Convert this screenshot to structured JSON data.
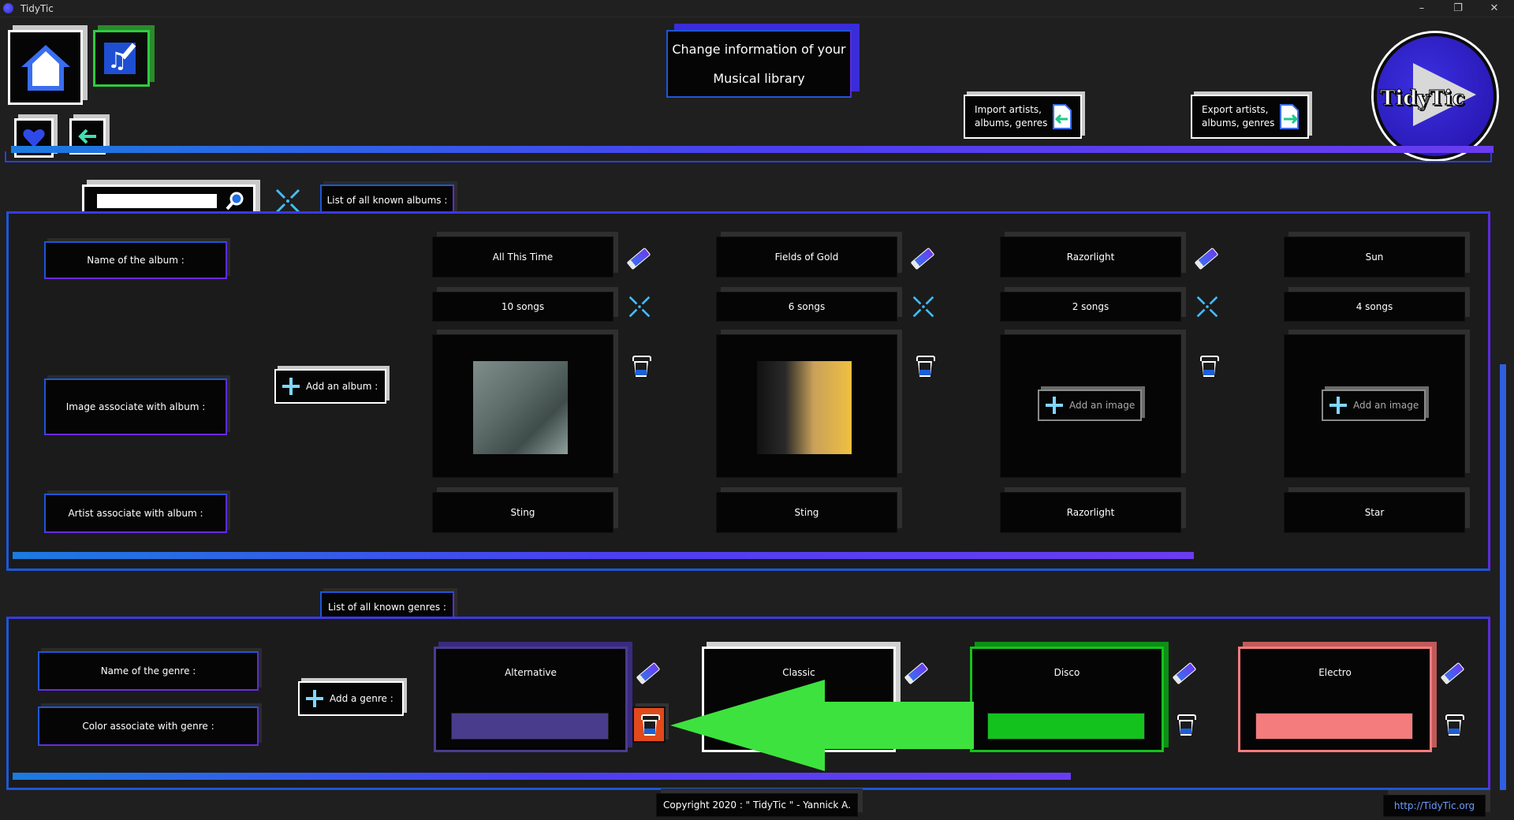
{
  "window": {
    "title": "TidyTic",
    "minimize": "–",
    "maximize": "❐",
    "close": "✕"
  },
  "header": {
    "title_line1": "Change information of your",
    "title_line2": "Musical library",
    "import_label_1": "Import artists,",
    "import_label_2": "albums, genres",
    "export_label_1": "Export artists,",
    "export_label_2": "albums, genres",
    "logo_text": "TidyTic"
  },
  "albums_section": {
    "tab_label": "List of all known albums :",
    "search_value": "",
    "row_labels": {
      "name": "Name of the album :",
      "image": "Image associate with album :",
      "artist": "Artist associate with album :"
    },
    "add_button": "Add an album :",
    "add_image_label": "Add an image",
    "albums": [
      {
        "name": "All This Time",
        "songs": "10 songs",
        "artist": "Sting",
        "has_image": true
      },
      {
        "name": "Fields of Gold",
        "songs": "6 songs",
        "artist": "Sting",
        "has_image": true
      },
      {
        "name": "Razorlight",
        "songs": "2 songs",
        "artist": "Razorlight",
        "has_image": false
      },
      {
        "name": "Sun",
        "songs": "4 songs",
        "artist": "Star",
        "has_image": false
      }
    ],
    "scroll_fraction": 0.8
  },
  "genres_section": {
    "tab_label": "List of all known genres :",
    "row_labels": {
      "name": "Name of the genre :",
      "color": "Color associate with genre :"
    },
    "add_button": "Add a genre :",
    "genres": [
      {
        "name": "Alternative",
        "color": "#4a3c8c"
      },
      {
        "name": "Classic",
        "color": "#ffffff"
      },
      {
        "name": "Disco",
        "color": "#14c21e"
      },
      {
        "name": "Electro",
        "color": "#f47c7c"
      }
    ],
    "scroll_fraction": 0.72
  },
  "footer": {
    "copyright": "Copyright 2020 : \" TidyTic \" - Yannick A.",
    "link": "http://TidyTic.org"
  },
  "colors": {
    "accent_blue": "#1d57d6",
    "accent_purple": "#6a3cf0",
    "arrow_green": "#3ee23e",
    "delete_active": "#e04a1a"
  }
}
